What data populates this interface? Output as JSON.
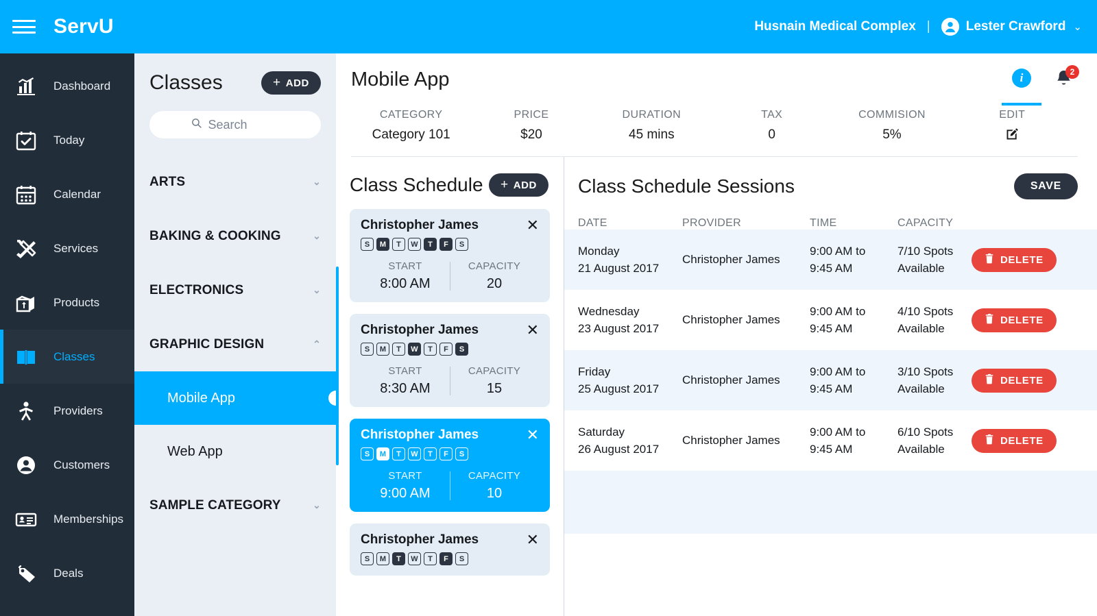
{
  "topbar": {
    "brand": "ServU",
    "org": "Husnain Medical Complex",
    "divider": "|",
    "user": "Lester Crawford",
    "caret": "⌄"
  },
  "sidebar": {
    "items": [
      {
        "label": "Dashboard",
        "icon": "chart-bar-icon",
        "active": false
      },
      {
        "label": "Today",
        "icon": "calendar-check-icon",
        "active": false
      },
      {
        "label": "Calendar",
        "icon": "calendar-icon",
        "active": false
      },
      {
        "label": "Services",
        "icon": "tools-icon",
        "active": false
      },
      {
        "label": "Products",
        "icon": "box-icon",
        "active": false
      },
      {
        "label": "Classes",
        "icon": "book-icon",
        "active": true
      },
      {
        "label": "Providers",
        "icon": "person-walk-icon",
        "active": false
      },
      {
        "label": "Customers",
        "icon": "user-circle-icon",
        "active": false
      },
      {
        "label": "Memberships",
        "icon": "id-card-icon",
        "active": false
      },
      {
        "label": "Deals",
        "icon": "tag-icon",
        "active": false
      }
    ]
  },
  "classpanel": {
    "title": "Classes",
    "add_label": "ADD",
    "add_plus": "+",
    "search_placeholder": "Search",
    "search_value": "",
    "categories": [
      {
        "label": "ARTS",
        "expanded": false,
        "chevron": "⌄"
      },
      {
        "label": "BAKING & COOKING",
        "expanded": false,
        "chevron": "⌄"
      },
      {
        "label": "ELECTRONICS",
        "expanded": false,
        "chevron": "⌄"
      },
      {
        "label": "GRAPHIC DESIGN",
        "expanded": true,
        "chevron": "⌃"
      },
      {
        "label": "SAMPLE CATEGORY",
        "expanded": false,
        "chevron": "⌄"
      }
    ],
    "classes": [
      {
        "label": "Mobile App",
        "selected": true
      },
      {
        "label": "Web App",
        "selected": false
      }
    ]
  },
  "main": {
    "title": "Mobile App",
    "info_tab_glyph": "i",
    "bell_badge": "2",
    "meta": [
      {
        "label": "CATEGORY",
        "value": "Category 101"
      },
      {
        "label": "PRICE",
        "value": "$20"
      },
      {
        "label": "DURATION",
        "value": "45 mins"
      },
      {
        "label": "TAX",
        "value": "0"
      },
      {
        "label": "COMMISION",
        "value": "5%"
      },
      {
        "label": "EDIT",
        "value": "",
        "icon": "edit-pencil-icon"
      }
    ]
  },
  "schedule": {
    "title": "Class Schedule",
    "add_label": "ADD",
    "add_plus": "+",
    "close_glyph": "✕",
    "day_letters": [
      "S",
      "M",
      "T",
      "W",
      "T",
      "F",
      "S"
    ],
    "labels": {
      "start": "START",
      "capacity": "CAPACITY"
    },
    "cards": [
      {
        "provider": "Christopher James",
        "days": [
          false,
          true,
          false,
          false,
          true,
          true,
          false
        ],
        "start": "8:00 AM",
        "capacity": "20",
        "selected": false
      },
      {
        "provider": "Christopher James",
        "days": [
          false,
          false,
          false,
          true,
          false,
          false,
          true
        ],
        "start": "8:30 AM",
        "capacity": "15",
        "selected": false
      },
      {
        "provider": "Christopher James",
        "days": [
          false,
          true,
          false,
          false,
          false,
          false,
          false
        ],
        "start": "9:00 AM",
        "capacity": "10",
        "selected": true
      },
      {
        "provider": "Christopher James",
        "days": [
          false,
          false,
          true,
          false,
          false,
          true,
          false
        ],
        "start": "",
        "capacity": "",
        "selected": false
      }
    ]
  },
  "sessions": {
    "title": "Class Schedule Sessions",
    "save_label": "SAVE",
    "delete_label": "DELETE",
    "columns": [
      "DATE",
      "PROVIDER",
      "TIME",
      "CAPACITY"
    ],
    "rows": [
      {
        "day": "Monday",
        "date": "21 August 2017",
        "provider": "Christopher James",
        "time_start": "9:00 AM to",
        "time_end": "9:45 AM",
        "capacity": "7/10 Spots",
        "capacity2": "Available"
      },
      {
        "day": "Wednesday",
        "date": "23 August 2017",
        "provider": "Christopher James",
        "time_start": "9:00 AM to",
        "time_end": "9:45 AM",
        "capacity": "4/10 Spots",
        "capacity2": "Available"
      },
      {
        "day": "Friday",
        "date": "25 August 2017",
        "provider": "Christopher James",
        "time_start": "9:00 AM to",
        "time_end": "9:45 AM",
        "capacity": "3/10 Spots",
        "capacity2": "Available"
      },
      {
        "day": "Saturday",
        "date": "26 August 2017",
        "provider": "Christopher James",
        "time_start": "9:00 AM to",
        "time_end": "9:45 AM",
        "capacity": "6/10 Spots",
        "capacity2": "Available"
      }
    ]
  },
  "colors": {
    "accent": "#00AEFF",
    "sidebar": "#222D3A",
    "panel": "#E9EFF5",
    "danger": "#E8453C",
    "dark_button": "#2B3440",
    "row_stripe": "#EFF5FC"
  }
}
